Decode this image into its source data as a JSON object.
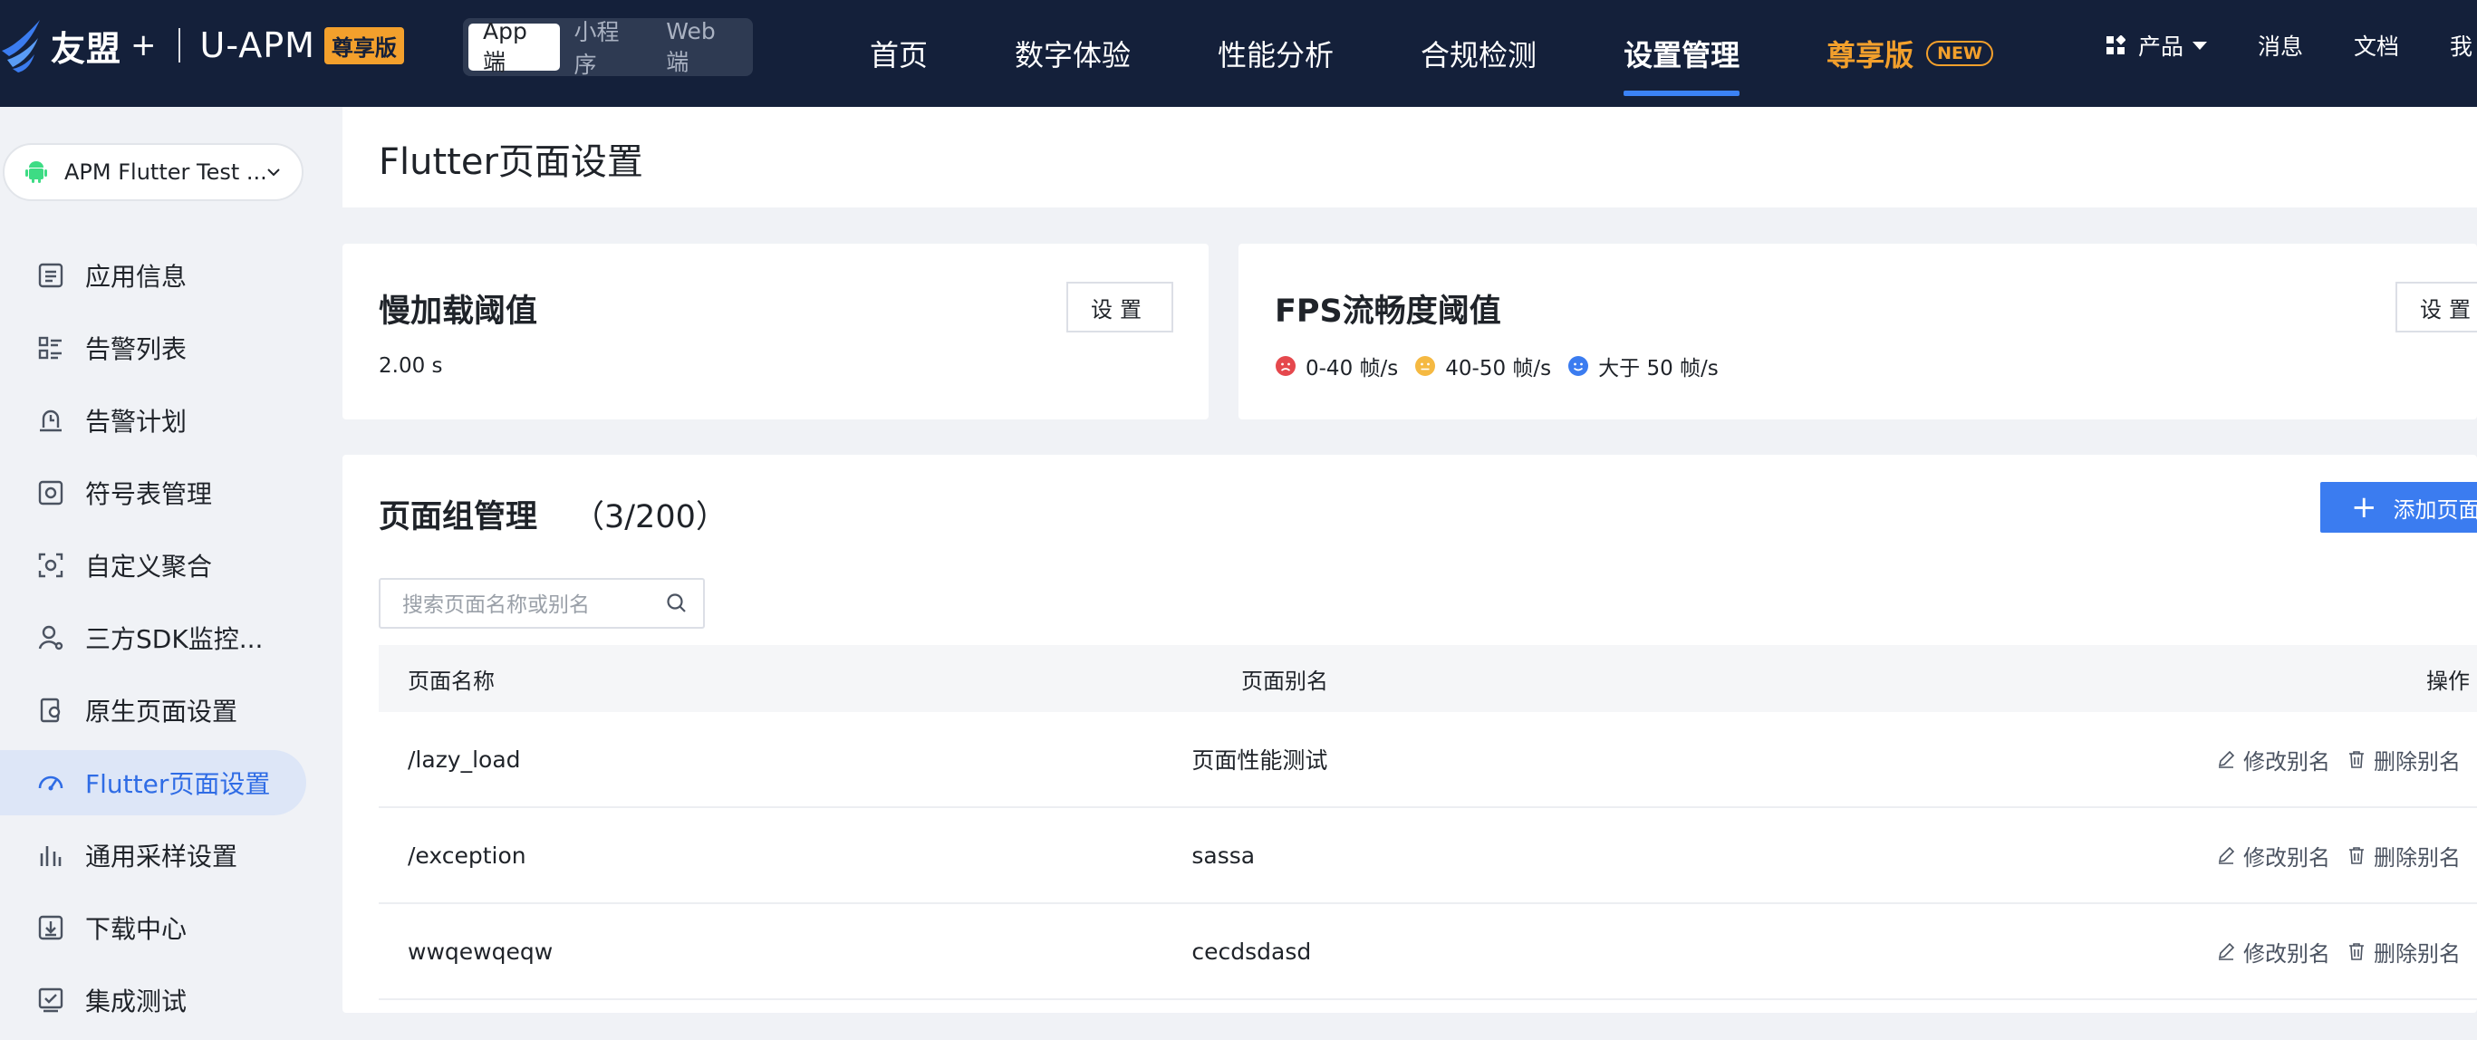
{
  "header": {
    "brand": "友盟",
    "brand_plus": "+",
    "product": "U-APM",
    "edition": "尊享版",
    "platform_tabs": [
      {
        "label": "App端",
        "active": true
      },
      {
        "label": "小程序",
        "active": false
      },
      {
        "label": "Web端",
        "active": false
      }
    ],
    "nav": [
      {
        "label": "首页",
        "active": false
      },
      {
        "label": "数字体验",
        "active": false
      },
      {
        "label": "性能分析",
        "active": false
      },
      {
        "label": "合规检测",
        "active": false
      },
      {
        "label": "设置管理",
        "active": true
      }
    ],
    "premium": {
      "label": "尊享版",
      "badge": "NEW"
    },
    "right": {
      "products": "产品",
      "messages": "消息",
      "docs": "文档",
      "me": "我"
    }
  },
  "sidebar": {
    "app_name": "APM Flutter Test ...",
    "items": [
      {
        "label": "应用信息",
        "icon": "app-info-icon",
        "active": false
      },
      {
        "label": "告警列表",
        "icon": "alarm-list-icon",
        "active": false
      },
      {
        "label": "告警计划",
        "icon": "alarm-plan-icon",
        "active": false
      },
      {
        "label": "符号表管理",
        "icon": "symbol-table-icon",
        "active": false
      },
      {
        "label": "自定义聚合",
        "icon": "custom-aggregate-icon",
        "active": false
      },
      {
        "label": "三方SDK监控...",
        "icon": "sdk-monitor-icon",
        "active": false
      },
      {
        "label": "原生页面设置",
        "icon": "native-page-icon",
        "active": false
      },
      {
        "label": "Flutter页面设置",
        "icon": "flutter-page-icon",
        "active": true
      },
      {
        "label": "通用采样设置",
        "icon": "sampling-icon",
        "active": false
      },
      {
        "label": "下载中心",
        "icon": "download-icon",
        "active": false
      },
      {
        "label": "集成测试",
        "icon": "integration-test-icon",
        "active": false
      }
    ]
  },
  "page": {
    "title": "Flutter页面设置"
  },
  "slow_load": {
    "title": "慢加载阈值",
    "value": "2.00 s",
    "button": "设置"
  },
  "fps": {
    "title": "FPS流畅度阈值",
    "button": "设置",
    "levels": [
      {
        "label": "0-40 帧/s",
        "color": "#e5484d",
        "mood": "sad"
      },
      {
        "label": "40-50 帧/s",
        "color": "#f5b942",
        "mood": "neutral"
      },
      {
        "label": "大于 50 帧/s",
        "color": "#3b7cf0",
        "mood": "happy"
      }
    ]
  },
  "groups": {
    "title": "页面组管理",
    "count": "（3/200）",
    "add_button": "添加页面",
    "search_placeholder": "搜索页面名称或别名",
    "search_value": "",
    "columns": {
      "name": "页面名称",
      "alias": "页面别名",
      "ops": "操作"
    },
    "rows": [
      {
        "name": "/lazy_load",
        "alias": "页面性能测试"
      },
      {
        "name": "/exception",
        "alias": "sassa"
      },
      {
        "name": "wwqewqeqw",
        "alias": "cecdsdasd"
      }
    ],
    "edit_label": "修改别名",
    "delete_label": "删除别名"
  },
  "colors": {
    "nav_bg": "#14203a",
    "accent": "#3b7cf0",
    "premium": "#f3a02c",
    "active_menu_bg": "#dde6f7"
  }
}
